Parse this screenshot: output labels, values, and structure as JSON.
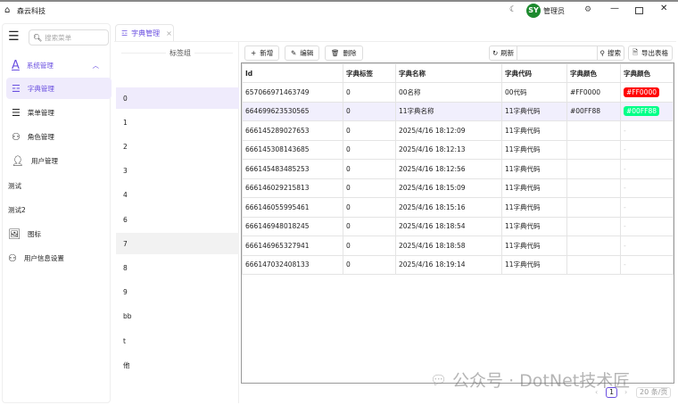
{
  "app": {
    "title": "森云科技",
    "user": "管理员",
    "avatar": "SY"
  },
  "sidebar": {
    "search_placeholder": "搜索菜单",
    "group": "系统管理",
    "items": [
      {
        "label": "字典管理",
        "icon": "dict-icon"
      },
      {
        "label": "菜单管理",
        "icon": "menu-icon"
      },
      {
        "label": "角色管理",
        "icon": "role-icon"
      },
      {
        "label": "用户管理",
        "icon": "user-icon"
      }
    ],
    "top_items": [
      {
        "label": "测试"
      },
      {
        "label": "测试2"
      },
      {
        "label": "图标"
      },
      {
        "label": "用户信息设置"
      }
    ]
  },
  "tab": {
    "label": "字典管理"
  },
  "label_group": {
    "title": "标签组",
    "items": [
      "0",
      "1",
      "2",
      "3",
      "4",
      "6",
      "7",
      "8",
      "9",
      "bb",
      "t",
      "他"
    ],
    "selected": "0",
    "hover": "7"
  },
  "toolbar": {
    "add": "新增",
    "edit": "编辑",
    "delete": "删除",
    "refresh": "刷新",
    "search_value": "",
    "search": "搜索",
    "export": "导出表格"
  },
  "table": {
    "headers": [
      "Id",
      "字典标签",
      "字典名称",
      "字典代码",
      "字典颜色",
      "字典颜色"
    ],
    "rows": [
      [
        "657066971463749",
        "0",
        "00名称",
        "00代码",
        "#FF0000",
        "#FF0000"
      ],
      [
        "664699623530565",
        "0",
        "11字典名称",
        "11字典代码",
        "#00FF88",
        "#00FF88"
      ],
      [
        "666145289027653",
        "0",
        "2025/4/16 18:12:09",
        "11字典代码",
        "",
        "-"
      ],
      [
        "666145308143685",
        "0",
        "2025/4/16 18:12:13",
        "11字典代码",
        "",
        "-"
      ],
      [
        "666145483485253",
        "0",
        "2025/4/16 18:12:56",
        "11字典代码",
        "",
        "-"
      ],
      [
        "666146029215813",
        "0",
        "2025/4/16 18:15:09",
        "11字典代码",
        "",
        "-"
      ],
      [
        "666146055995461",
        "0",
        "2025/4/16 18:15:16",
        "11字典代码",
        "",
        "-"
      ],
      [
        "666146948018245",
        "0",
        "2025/4/16 18:18:54",
        "11字典代码",
        "",
        "-"
      ],
      [
        "666146965327941",
        "0",
        "2025/4/16 18:18:58",
        "11字典代码",
        "",
        "-"
      ],
      [
        "666147032408133",
        "0",
        "2025/4/16 18:19:14",
        "11字典代码",
        "",
        "-"
      ]
    ],
    "selected_row": 1
  },
  "pagination": {
    "page": "1",
    "page_size": "20 条/页"
  },
  "watermark": "公众号 · DotNet技术匠",
  "colors": {
    "accent": "#6a4fe0",
    "red": "#FF0000",
    "green": "#00FF88"
  }
}
